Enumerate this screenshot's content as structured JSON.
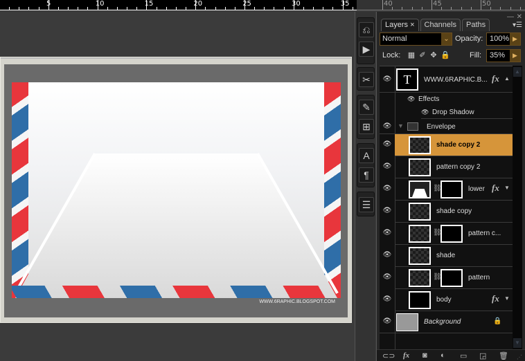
{
  "ruler": {
    "labels": [
      "5",
      "10",
      "15",
      "20",
      "25",
      "30",
      "35"
    ],
    "panel_labels": [
      "40",
      "45",
      "50"
    ]
  },
  "document": {
    "watermark": "WWW.6RAPHIC.BLOGSPOT.COM"
  },
  "toolstrip": {
    "icons": [
      "history-icon",
      "actions-icon",
      "tools-icon",
      "brushes-icon",
      "clone-source-icon",
      "character-icon",
      "paragraph-icon",
      "notes-icon"
    ]
  },
  "panel": {
    "tabs": [
      {
        "label": "Layers ×",
        "active": true
      },
      {
        "label": "Channels",
        "active": false
      },
      {
        "label": "Paths",
        "active": false
      }
    ],
    "blend_mode": "Normal",
    "opacity_label": "Opacity:",
    "opacity_value": "100%",
    "lock_label": "Lock:",
    "fill_label": "Fill:",
    "fill_value": "35%",
    "layers": [
      {
        "name": "WWW.6RAPHIC.B...",
        "type": "text",
        "thumb_glyph": "T",
        "fx": true
      },
      {
        "name": "Effects",
        "type": "effects-header"
      },
      {
        "name": "Drop Shadow",
        "type": "effect"
      },
      {
        "name": "Envelope",
        "type": "group"
      },
      {
        "name": "shade copy 2",
        "type": "layer",
        "selected": true
      },
      {
        "name": "pattern copy 2",
        "type": "layer"
      },
      {
        "name": "lower",
        "type": "masked",
        "fx": true
      },
      {
        "name": "shade copy",
        "type": "layer"
      },
      {
        "name": "pattern c...",
        "type": "masked"
      },
      {
        "name": "shade",
        "type": "layer"
      },
      {
        "name": "pattern",
        "type": "masked"
      },
      {
        "name": "body",
        "type": "layer",
        "fx": true
      },
      {
        "name": "Background",
        "type": "background",
        "locked": true
      }
    ],
    "fx_label": "fx",
    "bottom_icons": [
      "link-layers-icon",
      "add-style-icon",
      "add-mask-icon",
      "adjustment-layer-icon",
      "new-group-icon",
      "new-layer-icon",
      "delete-layer-icon"
    ]
  },
  "colors": {
    "selection": "#d6953a",
    "stripe_red": "#e8363c",
    "stripe_blue": "#2f6ea8"
  }
}
